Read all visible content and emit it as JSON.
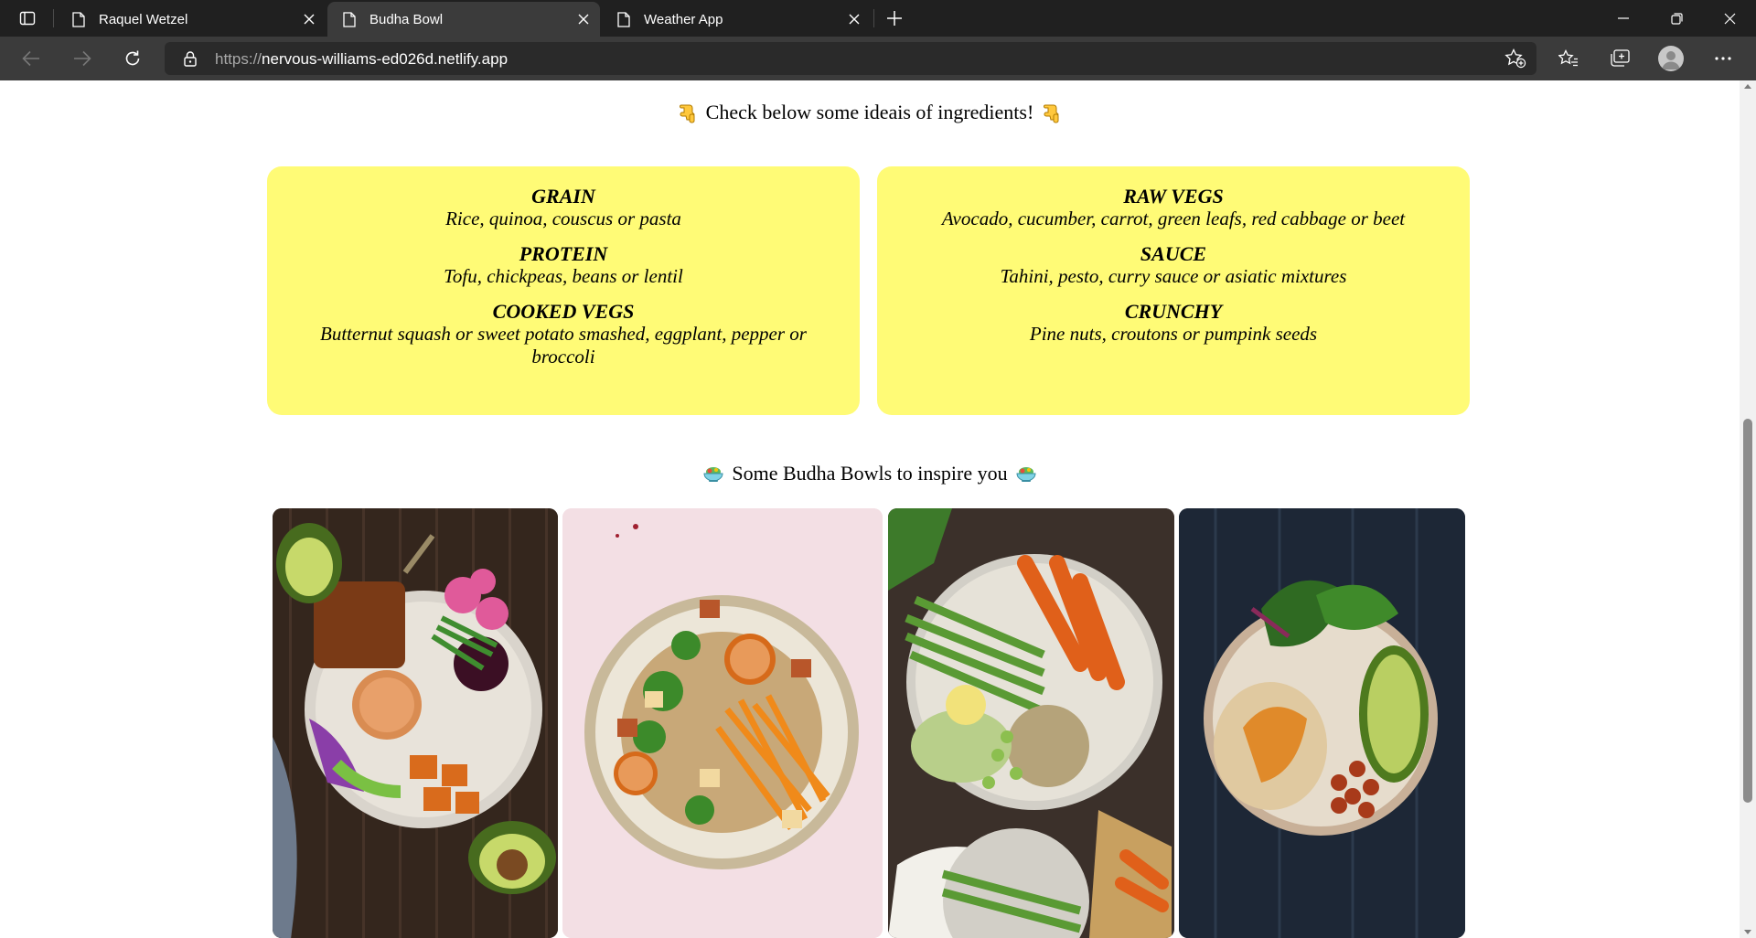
{
  "browser": {
    "tabs": [
      {
        "title": "Raquel Wetzel",
        "active": false
      },
      {
        "title": "Budha Bowl",
        "active": true
      },
      {
        "title": "Weather App",
        "active": false
      }
    ],
    "url_scheme": "https://",
    "url_host": "nervous-williams-ed026d.netlify.app",
    "icons": [
      "tab-actions-icon",
      "page-icon",
      "close-icon",
      "plus-icon",
      "minimize-icon",
      "restore-icon",
      "window-close-icon",
      "back-icon",
      "forward-icon",
      "refresh-icon",
      "lock-icon",
      "add-favorite-icon",
      "favorites-icon",
      "collections-icon",
      "profile-avatar",
      "more-icon"
    ]
  },
  "page": {
    "ingredients_heading": "Check below some ideais of ingredients!",
    "inspire_heading": "Some Budha Bowls to inspire you",
    "card_color": "#fffb76",
    "cards": [
      {
        "groups": [
          {
            "title": "GRAIN",
            "text": "Rice, quinoa, couscus or pasta"
          },
          {
            "title": "PROTEIN",
            "text": "Tofu, chickpeas, beans or lentil"
          },
          {
            "title": "COOKED VEGS",
            "text": "Butternut squash or sweet potato smashed, eggplant, pepper or broccoli"
          }
        ]
      },
      {
        "groups": [
          {
            "title": "RAW VEGS",
            "text": "Avocado, cucumber, carrot, green leafs, red cabbage or beet"
          },
          {
            "title": "SAUCE",
            "text": "Tahini, pesto, curry sauce or asiatic mixtures"
          },
          {
            "title": "CRUNCHY",
            "text": "Pine nuts, croutons or pumpink seeds"
          }
        ]
      }
    ],
    "photos": [
      "bowl-photo-1",
      "bowl-photo-2",
      "bowl-photo-3",
      "bowl-photo-4"
    ]
  }
}
